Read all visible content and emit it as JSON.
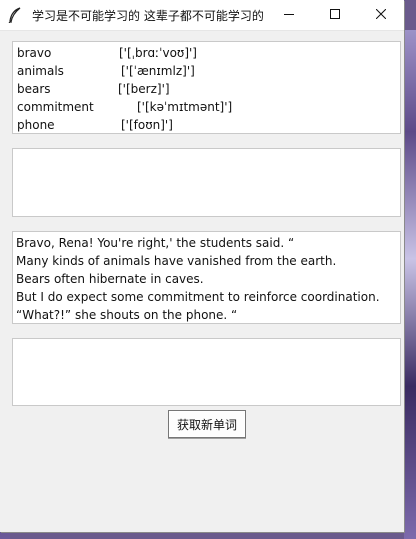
{
  "window": {
    "title": "学习是不可能学习的 这辈子都不可能学习的",
    "icon": "feather-icon",
    "controls": [
      "minimize-icon",
      "maximize-icon",
      "close-icon"
    ]
  },
  "vocab": [
    {
      "word": "bravo",
      "phonetic": "['[ˌbrɑːˈvoʊ]']"
    },
    {
      "word": "animals",
      "phonetic": "['[ˈænɪmlz]']"
    },
    {
      "word": "bears",
      "phonetic": "['[berz]']"
    },
    {
      "word": "commitment",
      "phonetic": "['[kəˈmɪtmənt]']"
    },
    {
      "word": "phone",
      "phonetic": "['[foʊn]']"
    }
  ],
  "input1": {
    "value": ""
  },
  "sentences": [
    "Bravo, Rena! You're right,' the students said. “",
    "Many kinds of animals have vanished from the earth.",
    "Bears often hibernate in caves.",
    "But I do expect some commitment to reinforce coordination.",
    "“What?!” she shouts on the phone. “"
  ],
  "input2": {
    "value": ""
  },
  "button": {
    "label": "获取新单词"
  }
}
